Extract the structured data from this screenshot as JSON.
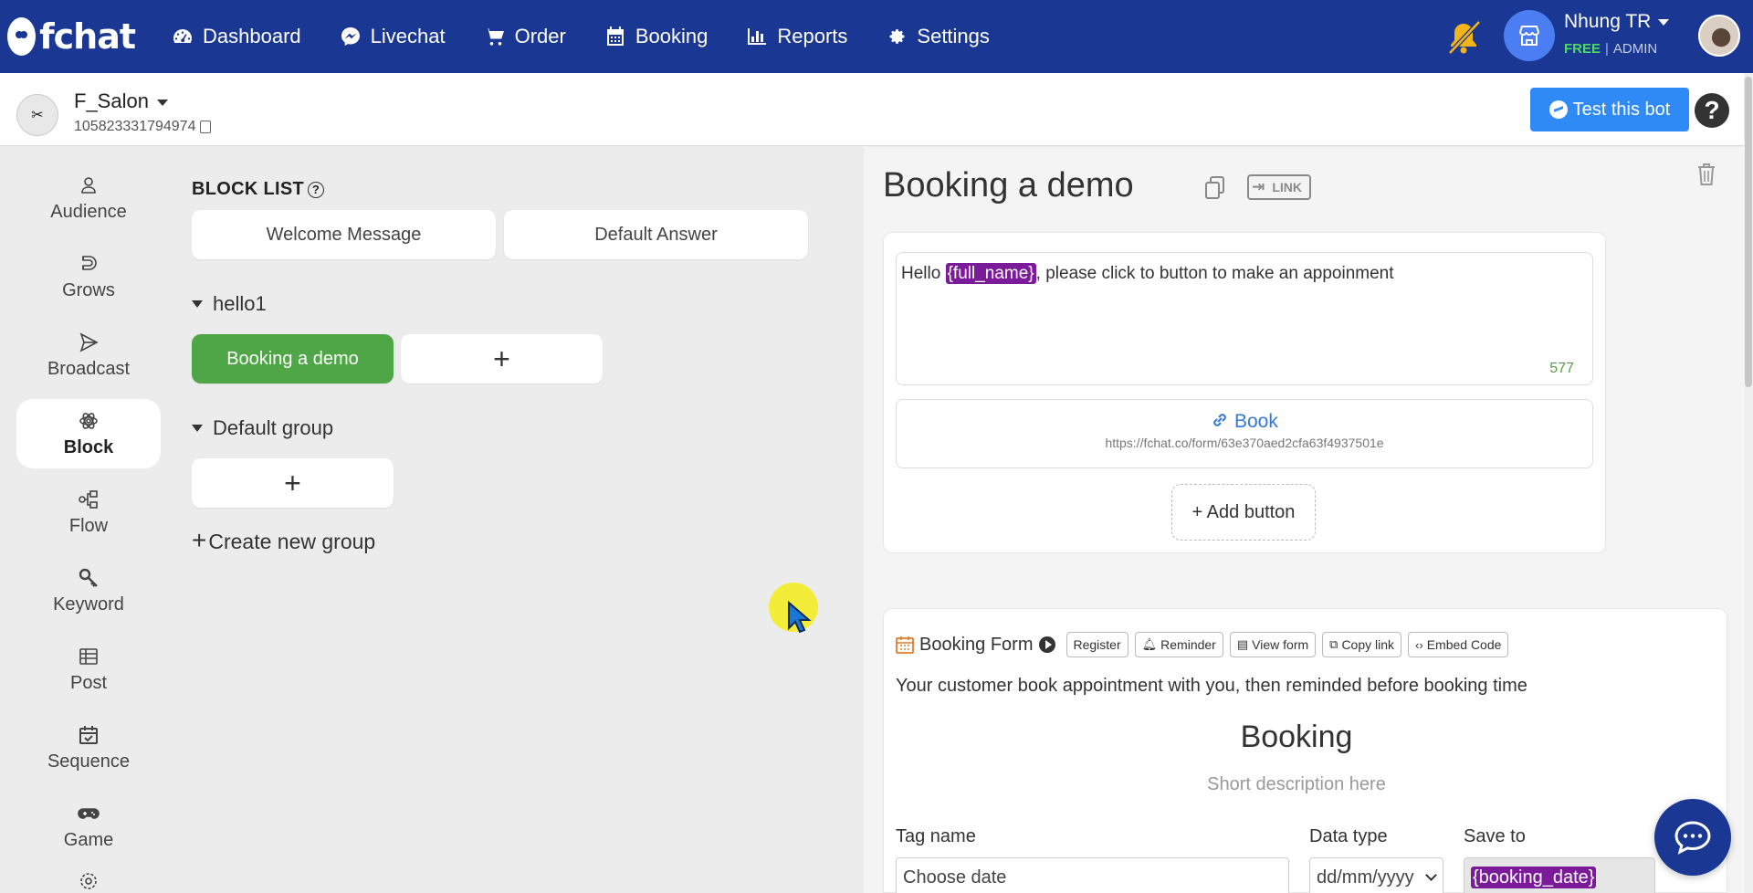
{
  "app": {
    "logo_text": "fchat",
    "nav": [
      {
        "label": "Dashboard",
        "icon": "dashboard-icon"
      },
      {
        "label": "Livechat",
        "icon": "messenger-icon"
      },
      {
        "label": "Order",
        "icon": "cart-icon"
      },
      {
        "label": "Booking",
        "icon": "calendar-icon"
      },
      {
        "label": "Reports",
        "icon": "bar-chart-icon"
      },
      {
        "label": "Settings",
        "icon": "gear-icon"
      }
    ],
    "user": {
      "name": "Nhung TR",
      "plan": "FREE",
      "role": "ADMIN"
    },
    "colors": {
      "nav_bg": "#1a3893",
      "accent_green": "#4ea646",
      "accent_blue": "#2f8af5",
      "variable_chip": "#7c1b9a"
    }
  },
  "page": {
    "name": "F_Salon",
    "id": "105823331794974",
    "test_bot_label": "Test this bot",
    "help_label": "?"
  },
  "sidebar": {
    "items": [
      {
        "label": "Audience",
        "icon": "user-icon"
      },
      {
        "label": "Grows",
        "icon": "magnet-icon"
      },
      {
        "label": "Broadcast",
        "icon": "send-icon"
      },
      {
        "label": "Block",
        "icon": "atom-icon",
        "active": true
      },
      {
        "label": "Flow",
        "icon": "flow-icon"
      },
      {
        "label": "Keyword",
        "icon": "key-icon"
      },
      {
        "label": "Post",
        "icon": "table-icon"
      },
      {
        "label": "Sequence",
        "icon": "calendar-check-icon"
      },
      {
        "label": "Game",
        "icon": "gamepad-icon"
      }
    ]
  },
  "block_list": {
    "title": "BLOCK LIST",
    "default_blocks": [
      "Welcome Message",
      "Default Answer"
    ],
    "groups": [
      {
        "name": "hello1",
        "blocks": [
          "Booking a demo"
        ],
        "add_label": "+"
      },
      {
        "name": "Default group",
        "blocks": [],
        "add_label": "+"
      }
    ],
    "create_group_label": "Create new group",
    "create_group_plus": "+"
  },
  "editor": {
    "title": "Booking a demo",
    "link_label": "LINK",
    "message": {
      "prefix": "Hello ",
      "variable": "{full_name}",
      "suffix": ", please click to button to make an appoinment",
      "char_count": "577"
    },
    "button": {
      "label": "Book",
      "url": "https://fchat.co/form/63e370aed2cfa63f4937501e"
    },
    "add_button_label": "+ Add button",
    "form": {
      "header": "Booking Form",
      "chips": [
        "Register",
        "Reminder",
        "View form",
        "Copy link",
        "Embed Code"
      ],
      "description": "Your customer book appointment with you, then reminded before booking time",
      "title": "Booking",
      "subtitle": "Short description here",
      "columns": [
        "Tag name",
        "Data type",
        "Save to"
      ],
      "row": {
        "tag_name_placeholder": "Choose date",
        "data_type_value": "dd/mm/yyyy",
        "save_to_value": "{booking_date}"
      }
    }
  }
}
